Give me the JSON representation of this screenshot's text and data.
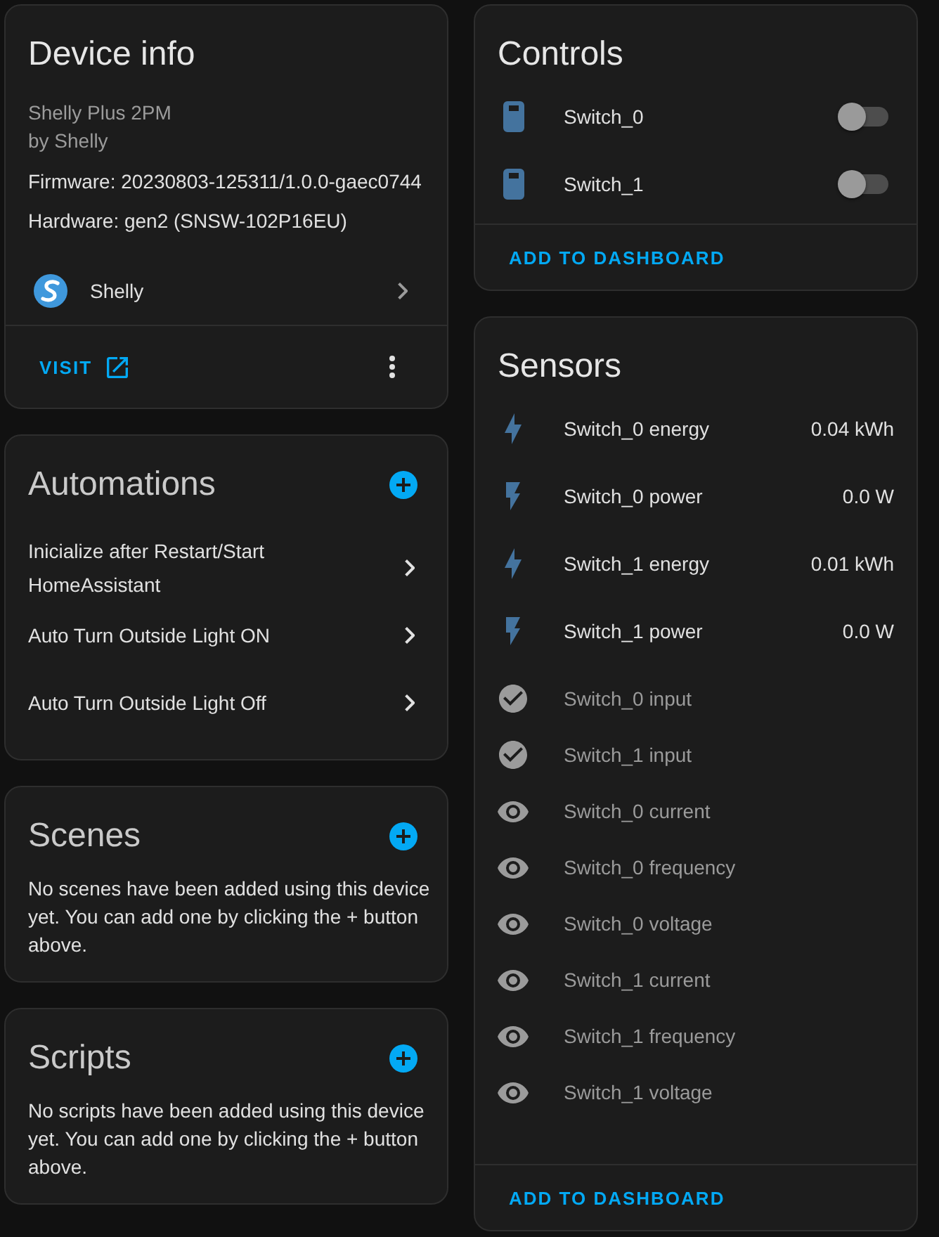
{
  "device_info": {
    "title": "Device info",
    "model": "Shelly Plus 2PM",
    "manufacturer": "by Shelly",
    "firmware": "Firmware: 20230803-125311/1.0.0-gaec0744",
    "hardware": "Hardware: gen2 (SNSW-102P16EU)",
    "integration": "Shelly",
    "action": "VISIT"
  },
  "automations": {
    "title": "Automations",
    "items": [
      "Inicialize after Restart/Start HomeAssistant",
      "Auto Turn Outside Light ON",
      "Auto Turn Outside Light Off"
    ]
  },
  "scenes": {
    "title": "Scenes",
    "empty_text": "No scenes have been added using this device yet. You can add one by clicking the + button above."
  },
  "scripts": {
    "title": "Scripts",
    "empty_text": "No scripts have been added using this device yet. You can add one by clicking the + button above."
  },
  "controls": {
    "title": "Controls",
    "items": [
      {
        "name": "Switch_0",
        "on": false
      },
      {
        "name": "Switch_1",
        "on": false
      }
    ],
    "action": "ADD TO DASHBOARD"
  },
  "sensors": {
    "title": "Sensors",
    "items": [
      {
        "kind": "energy",
        "name": "Switch_0 energy",
        "value": "0.04 kWh",
        "disabled": false
      },
      {
        "kind": "power",
        "name": "Switch_0 power",
        "value": "0.0 W",
        "disabled": false
      },
      {
        "kind": "energy",
        "name": "Switch_1 energy",
        "value": "0.01 kWh",
        "disabled": false
      },
      {
        "kind": "power",
        "name": "Switch_1 power",
        "value": "0.0 W",
        "disabled": false
      },
      {
        "kind": "input",
        "name": "Switch_0 input",
        "disabled": true
      },
      {
        "kind": "input",
        "name": "Switch_1 input",
        "disabled": true
      },
      {
        "kind": "measurement",
        "name": "Switch_0 current",
        "disabled": true
      },
      {
        "kind": "measurement",
        "name": "Switch_0 frequency",
        "disabled": true
      },
      {
        "kind": "measurement",
        "name": "Switch_0 voltage",
        "disabled": true
      },
      {
        "kind": "measurement",
        "name": "Switch_1 current",
        "disabled": true
      },
      {
        "kind": "measurement",
        "name": "Switch_1 frequency",
        "disabled": true
      },
      {
        "kind": "measurement",
        "name": "Switch_1 voltage",
        "disabled": true
      }
    ],
    "action": "ADD TO DASHBOARD"
  }
}
